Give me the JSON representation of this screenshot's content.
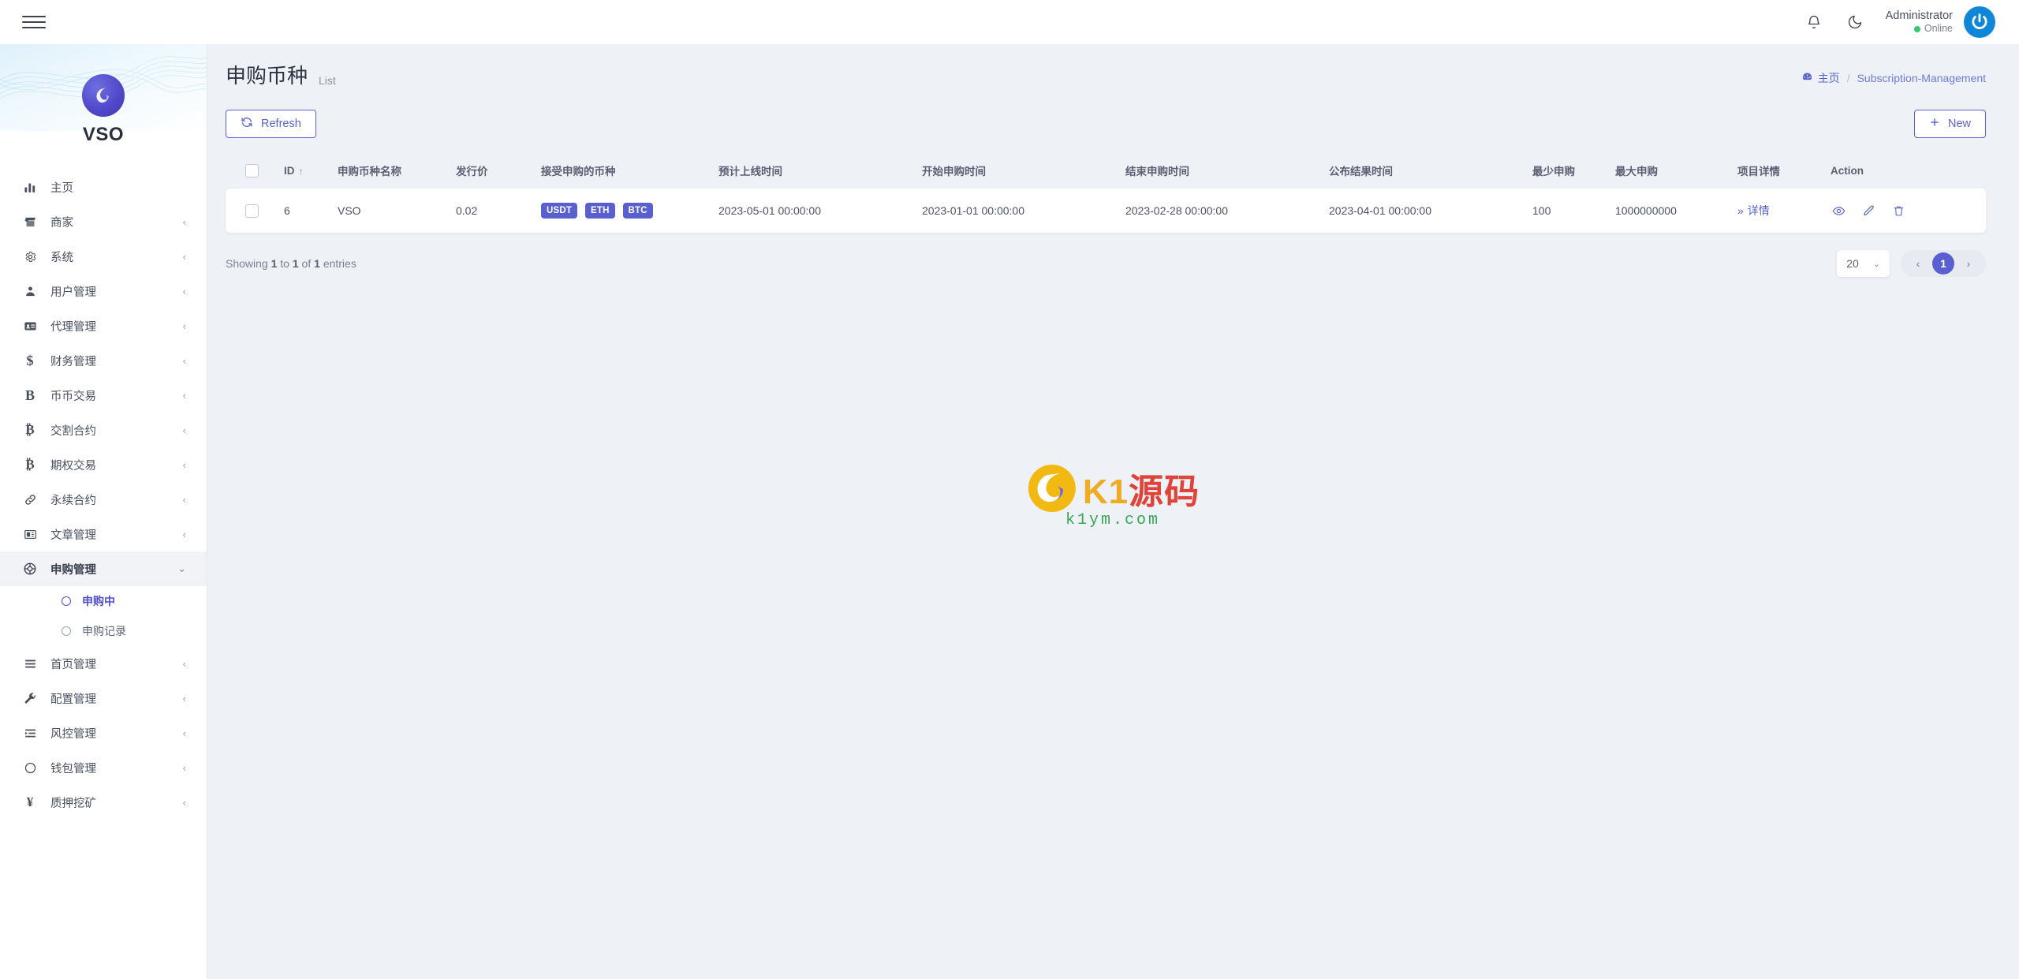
{
  "topbar": {
    "menu_toggle": "hamburger-menu",
    "notification_icon": "bell-icon",
    "theme_icon": "moon-icon",
    "user_name": "Administrator",
    "user_status": "Online"
  },
  "sidebar": {
    "brand": "VSO",
    "items": [
      {
        "label": "主页",
        "icon": "chart-bar-icon",
        "has_children": false,
        "active": false
      },
      {
        "label": "商家",
        "icon": "store-icon",
        "has_children": true,
        "active": false
      },
      {
        "label": "系统",
        "icon": "gear-icon",
        "has_children": true,
        "active": false
      },
      {
        "label": "用户管理",
        "icon": "user-icon",
        "has_children": true,
        "active": false
      },
      {
        "label": "代理管理",
        "icon": "id-card-icon",
        "has_children": true,
        "active": false
      },
      {
        "label": "财务管理",
        "icon": "dollar-icon",
        "has_children": true,
        "active": false
      },
      {
        "label": "币币交易",
        "icon": "letter-b-icon",
        "has_children": true,
        "active": false
      },
      {
        "label": "交割合约",
        "icon": "bitcoin-icon",
        "has_children": true,
        "active": false
      },
      {
        "label": "期权交易",
        "icon": "bitcoin-icon",
        "has_children": true,
        "active": false
      },
      {
        "label": "永续合约",
        "icon": "link-icon",
        "has_children": true,
        "active": false
      },
      {
        "label": "文章管理",
        "icon": "news-icon",
        "has_children": true,
        "active": false
      },
      {
        "label": "申购管理",
        "icon": "lifebuoy-icon",
        "has_children": true,
        "active": true
      },
      {
        "label": "首页管理",
        "icon": "list-icon",
        "has_children": true,
        "active": false
      },
      {
        "label": "配置管理",
        "icon": "wrench-icon",
        "has_children": true,
        "active": false
      },
      {
        "label": "风控管理",
        "icon": "indent-icon",
        "has_children": true,
        "active": false
      },
      {
        "label": "钱包管理",
        "icon": "circle-icon",
        "has_children": true,
        "active": false
      },
      {
        "label": "质押挖矿",
        "icon": "yen-icon",
        "has_children": true,
        "active": false
      }
    ],
    "submenu_parent_index": 11,
    "submenu": [
      {
        "label": "申购中",
        "active": true
      },
      {
        "label": "申购记录",
        "active": false
      }
    ]
  },
  "page": {
    "title": "申购币种",
    "subtitle": "List",
    "breadcrumb_home": "主页",
    "breadcrumb_sep": "/",
    "breadcrumb_current": "Subscription-Management"
  },
  "toolbar": {
    "refresh_label": "Refresh",
    "refresh_icon": "refresh-icon",
    "new_label": "New",
    "new_icon": "plus-icon"
  },
  "table": {
    "columns": [
      "",
      "ID",
      "申购币种名称",
      "发行价",
      "接受申购的币种",
      "预计上线时间",
      "开始申购时间",
      "结束申购时间",
      "公布结果时间",
      "最少申购",
      "最大申购",
      "项目详情",
      "Action"
    ],
    "sort_column": "ID",
    "sort_direction": "↑",
    "rows": [
      {
        "id": "6",
        "name": "VSO",
        "issue_price": "0.02",
        "accepted_coins": [
          "USDT",
          "ETH",
          "BTC"
        ],
        "expected_online_time": "2023-05-01 00:00:00",
        "start_time": "2023-01-01 00:00:00",
        "end_time": "2023-02-28 00:00:00",
        "result_time": "2023-04-01 00:00:00",
        "min_subscription": "100",
        "max_subscription": "1000000000",
        "detail_label": "详情",
        "detail_prefix": "»",
        "actions": [
          "eye-icon",
          "edit-icon",
          "trash-icon"
        ]
      }
    ]
  },
  "footer": {
    "entries_prefix": "Showing",
    "entries_from": "1",
    "entries_to_word": "to",
    "entries_to": "1",
    "entries_of_word": "of",
    "entries_total": "1",
    "entries_suffix": "entries",
    "page_size": "20",
    "prev_label": "‹",
    "next_label": "›",
    "current_page": "1"
  },
  "watermark": {
    "text_main": "K1",
    "text_cn": "源码",
    "text_sub": "k1ym.com"
  },
  "colors": {
    "accent": "#5a5fd0",
    "badge": "#5a5fd0",
    "page_bg": "#eef1f6",
    "online": "#2ecc71",
    "avatar": "#0f86d8"
  }
}
